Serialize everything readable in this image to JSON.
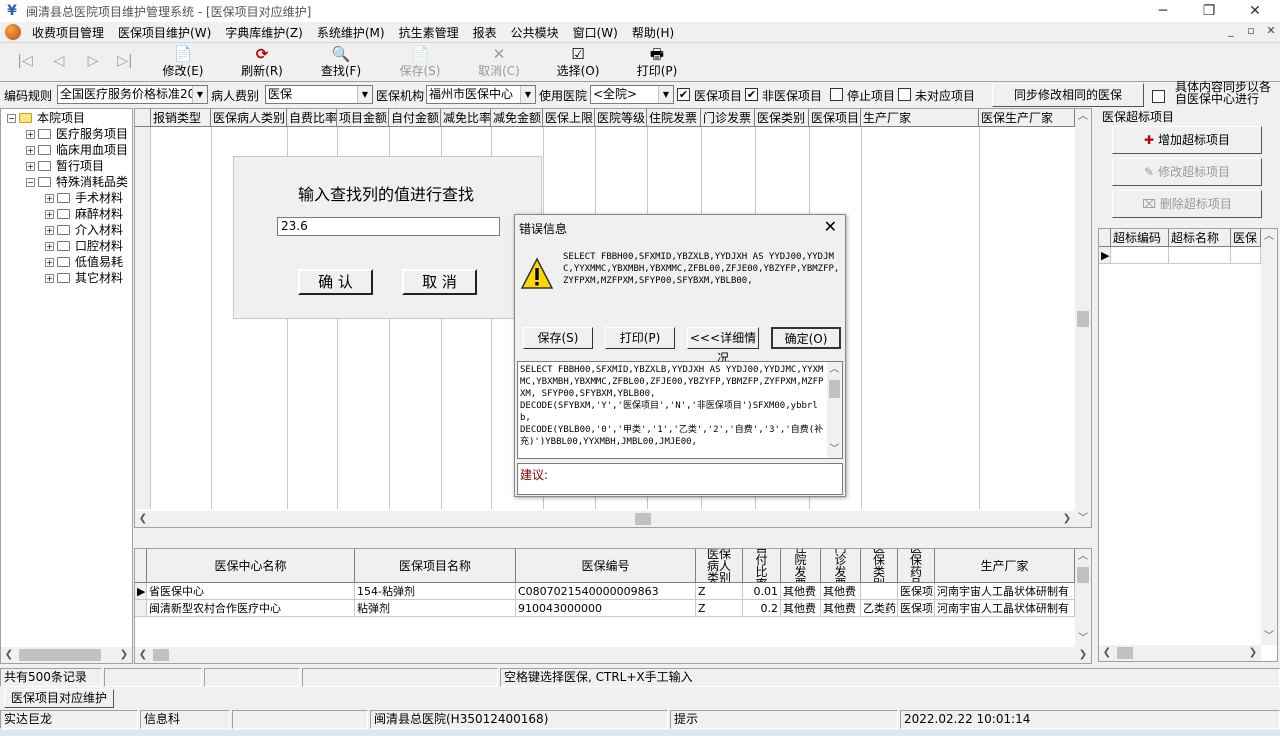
{
  "window": {
    "title": "闽清县总医院项目维护管理系统 - [医保项目对应维护]",
    "minimize": "─",
    "restore": "❐",
    "close": "✕"
  },
  "menu": {
    "items": [
      "收费项目管理",
      "医保项目维护(W)",
      "字典库维护(Z)",
      "系统维护(M)",
      "抗生素管理",
      "报表",
      "公共模块",
      "窗口(W)",
      "帮助(H)"
    ],
    "mdi_minimize": "_",
    "mdi_restore": "▫",
    "mdi_close": "✕"
  },
  "toolbar": {
    "nav": [
      "|◁",
      "◁",
      "▷",
      "▷|"
    ],
    "buttons": [
      {
        "label": "修改(E)",
        "icon": "📄",
        "enabled": true
      },
      {
        "label": "刷新(R)",
        "icon": "⟳",
        "enabled": true
      },
      {
        "label": "查找(F)",
        "icon": "🔍",
        "enabled": true
      },
      {
        "label": "保存(S)",
        "icon": "📄",
        "enabled": false
      },
      {
        "label": "取消(C)",
        "icon": "✕",
        "enabled": false
      },
      {
        "label": "选择(O)",
        "icon": "☑",
        "enabled": true
      },
      {
        "label": "打印(P)",
        "icon": "🖶",
        "enabled": true
      }
    ]
  },
  "filters": {
    "code_rule_label": "编码规则",
    "code_rule_value": "全国医疗服务价格标准20",
    "patient_fee_label": "病人费别",
    "patient_fee_value": "医保",
    "insurer_label": "医保机构",
    "insurer_value": "福州市医保中心",
    "hospital_label": "使用医院",
    "hospital_value": "<全院>",
    "chk_insured": "医保项目",
    "chk_insured_checked": "✔",
    "chk_non_insured": "非医保项目",
    "chk_non_insured_checked": "✔",
    "chk_stopped": "停止项目",
    "chk_unmatched": "未对应项目",
    "sync_button": "同步修改相同的医保",
    "sync_detail_label": "具体内容同步以各自医保中心进行"
  },
  "tree": {
    "root": "本院项目",
    "items": [
      {
        "label": "医疗服务项目",
        "level": 1
      },
      {
        "label": "临床用血项目",
        "level": 1
      },
      {
        "label": "暂行项目",
        "level": 1
      },
      {
        "label": "特殊消耗品类",
        "level": 1
      },
      {
        "label": "手术材料",
        "level": 2
      },
      {
        "label": "麻醉材料",
        "level": 2
      },
      {
        "label": "介入材料",
        "level": 2
      },
      {
        "label": "口腔材料",
        "level": 2
      },
      {
        "label": "低值易耗",
        "level": 2
      },
      {
        "label": "其它材料",
        "level": 2
      }
    ]
  },
  "main_grid": {
    "columns": [
      "报销类型",
      "医保病人类别",
      "自费比率",
      "项目金额",
      "自付金额",
      "减免比率",
      "减免金额",
      "医保上限",
      "医院等级",
      "住院发票",
      "门诊发票",
      "医保类别",
      "医保项目",
      "生产厂家",
      "医保生产厂家"
    ]
  },
  "find_panel": {
    "title": "输入查找列的值进行查找",
    "value": "23.6",
    "ok": "确 认",
    "cancel": "取 消"
  },
  "error_dialog": {
    "title": "错误信息",
    "close": "✕",
    "message": "SELECT FBBH00,SFXMID,YBZXLB,YYDJXH AS YYDJ00,YYDJMC,YYXMMC,YBXMBH,YBXMMC,ZFBL00,ZFJE00,YBZYFP,YBMZFP,ZYFPXM,MZFPXM,SFYP00,SFYBXM,YBLB00,",
    "buttons": [
      "保存(S)",
      "打印(P)",
      "<<<详细情况",
      "确定(O)"
    ],
    "detail": "SELECT FBBH00,SFXMID,YBZXLB,YYDJXH AS YYDJ00,YYDJMC,YYXMMC,YBXMBH,YBXMMC,ZFBL00,ZFJE00,YBZYFP,YBMZFP,ZYFPXM,MZFPXM, SFYP00,SFYBXM,YBLB00,\nDECODE(SFYBXM,'Y','医保项目','N','非医保项目')SFXM00,ybbrlb,\nDECODE(YBLB00,'0','甲类','1','乙类','2','自费','3','自费(补充)')YBBL00,YYXMBH,JMBL00,JMJE00,",
    "suggestion_label": "建议:"
  },
  "right_panel": {
    "title": "医保超标项目",
    "add_button": "增加超标项目",
    "edit_button": "修改超标项目",
    "delete_button": "删除超标项目",
    "columns": [
      "超标编码",
      "超标名称",
      "医保"
    ]
  },
  "detail_grid": {
    "columns": [
      "医保中心名称",
      "医保项目名称",
      "医保编号",
      "医保病人类别",
      "自付比率",
      "住院发票",
      "门诊发票",
      "医保类别",
      "医保药品",
      "生产厂家"
    ],
    "rows": [
      [
        "省医保中心",
        "154-粘弹剂",
        "C0807021540000009863",
        "Z",
        "0.01",
        "其他费",
        "其他费",
        "",
        "医保项",
        "河南宇宙人工晶状体研制有"
      ],
      [
        "闽清新型农村合作医疗中心",
        "粘弹剂",
        "910043000000",
        "Z",
        "0.2",
        "其他费",
        "其他费",
        "乙类药",
        "医保项",
        "河南宇宙人工晶状体研制有"
      ]
    ]
  },
  "status": {
    "record_count": "共有500条记录",
    "hint": "空格键选择医保, CTRL+X手工输入",
    "tab": "医保项目对应维护",
    "company": "实达巨龙",
    "department": "信息科",
    "hospital": "闽清县总医院(H35012400168)",
    "prompt": "提示",
    "datetime": "2022.02.22  10:01:14"
  }
}
